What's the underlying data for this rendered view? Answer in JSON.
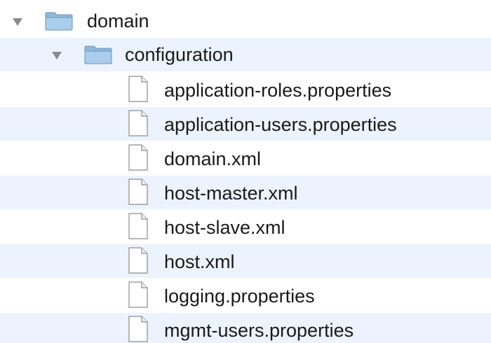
{
  "tree": {
    "root": {
      "label": "domain",
      "icon": "folder-icon",
      "expanded": true,
      "children": [
        {
          "label": "configuration",
          "icon": "folder-icon",
          "expanded": true,
          "children": [
            {
              "label": "application-roles.properties",
              "icon": "document-icon"
            },
            {
              "label": "application-users.properties",
              "icon": "document-icon"
            },
            {
              "label": "domain.xml",
              "icon": "document-icon"
            },
            {
              "label": "host-master.xml",
              "icon": "document-icon"
            },
            {
              "label": "host-slave.xml",
              "icon": "document-icon"
            },
            {
              "label": "host.xml",
              "icon": "document-icon"
            },
            {
              "label": "logging.properties",
              "icon": "document-icon"
            },
            {
              "label": "mgmt-users.properties",
              "icon": "document-icon"
            }
          ]
        }
      ]
    }
  },
  "colors": {
    "alt_row": "#edf3fe",
    "folder_fill": "#9cc4e4",
    "disclosure": "#8a8a8a"
  }
}
